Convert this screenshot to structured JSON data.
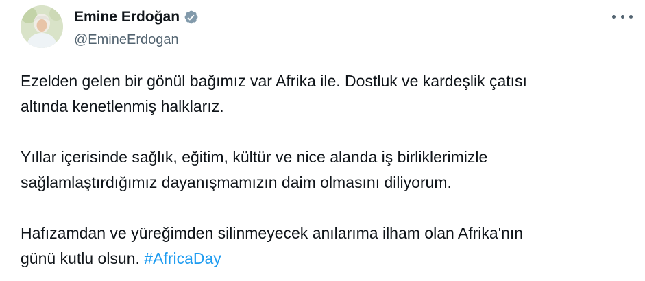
{
  "author": {
    "display_name": "Emine Erdoğan",
    "handle": "@EmineErdogan",
    "verified_icon": "verified-badge-icon",
    "avatar": "profile-photo"
  },
  "actions": {
    "more_icon": "more-options-icon"
  },
  "tweet": {
    "p1_line1": "Ezelden gelen bir gönül bağımız var Afrika ile. Dostluk ve kardeşlik çatısı",
    "p1_line2": "altında kenetlenmiş halklarız.",
    "p2_line1": "Yıllar içerisinde sağlık, eğitim, kültür ve nice alanda iş birliklerimizle",
    "p2_line2": "sağlamlaştırdığımız dayanışmamızın daim olmasını diliyorum.",
    "p3_line1": "Hafızamdan ve yüreğimden silinmeyecek anılarıma ilham olan Afrika'nın",
    "p3_line2": "günü kutlu olsun.",
    "hashtag": "#AfricaDay"
  },
  "colors": {
    "text": "#0f1419",
    "secondary": "#536471",
    "link": "#1d9bf0",
    "verified_badge": "#829aab"
  }
}
